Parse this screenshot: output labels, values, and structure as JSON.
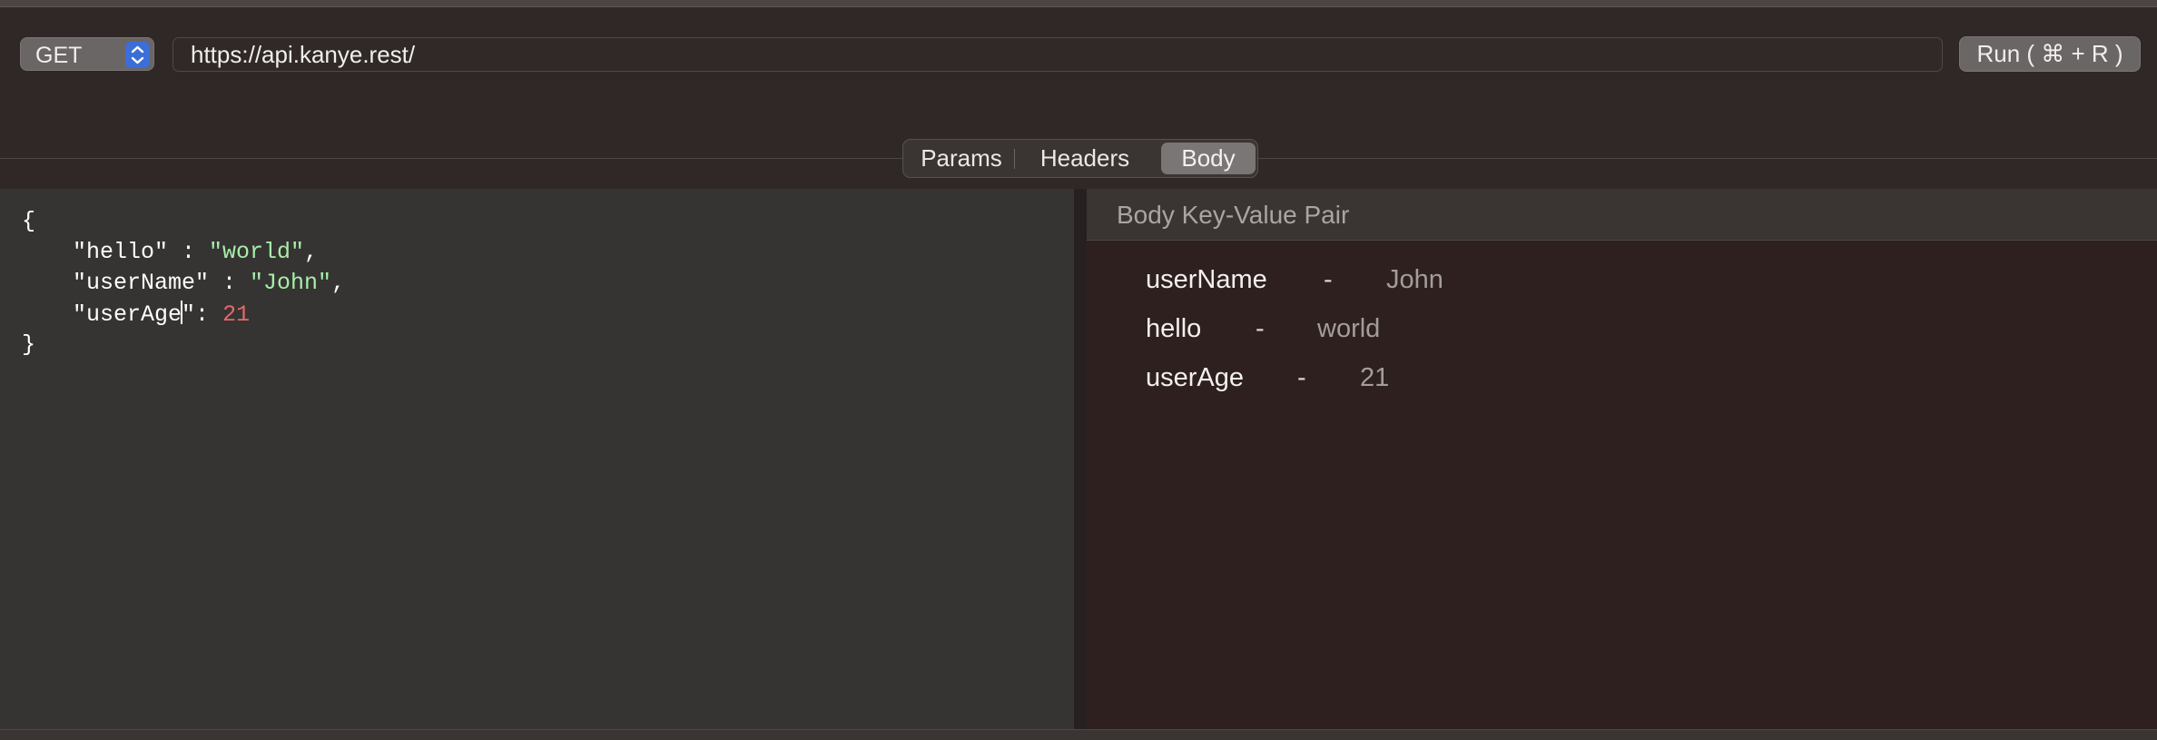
{
  "request": {
    "method": "GET",
    "url": "https://api.kanye.rest/",
    "run_label": "Run ( ⌘ + R )"
  },
  "tabs": [
    {
      "label": "Params",
      "selected": false
    },
    {
      "label": "Headers",
      "selected": false
    },
    {
      "label": "Body",
      "selected": true
    }
  ],
  "editor": {
    "open_brace": "{",
    "close_brace": "}",
    "lines": [
      {
        "key": "\"hello\"",
        "sep": " : ",
        "value": "\"world\"",
        "trail": ","
      },
      {
        "key": "\"userName\"",
        "sep": " : ",
        "value": "\"John\"",
        "trail": ","
      },
      {
        "key_before_caret": "\"userAge",
        "key_after_caret": "\"",
        "sep": ": ",
        "value": "21",
        "trail": ""
      }
    ]
  },
  "panel": {
    "title": "Body Key-Value Pair",
    "pairs": [
      {
        "key": "userName",
        "dash": "-",
        "value": "John"
      },
      {
        "key": "hello",
        "dash": "-",
        "value": "world"
      },
      {
        "key": "userAge",
        "dash": "-",
        "value": "21"
      }
    ]
  },
  "colors": {
    "string": "#a9eea7",
    "number": "#e46a6a",
    "selected_tab": "#7a7675",
    "stepper_accent": "#3c6ed8"
  }
}
